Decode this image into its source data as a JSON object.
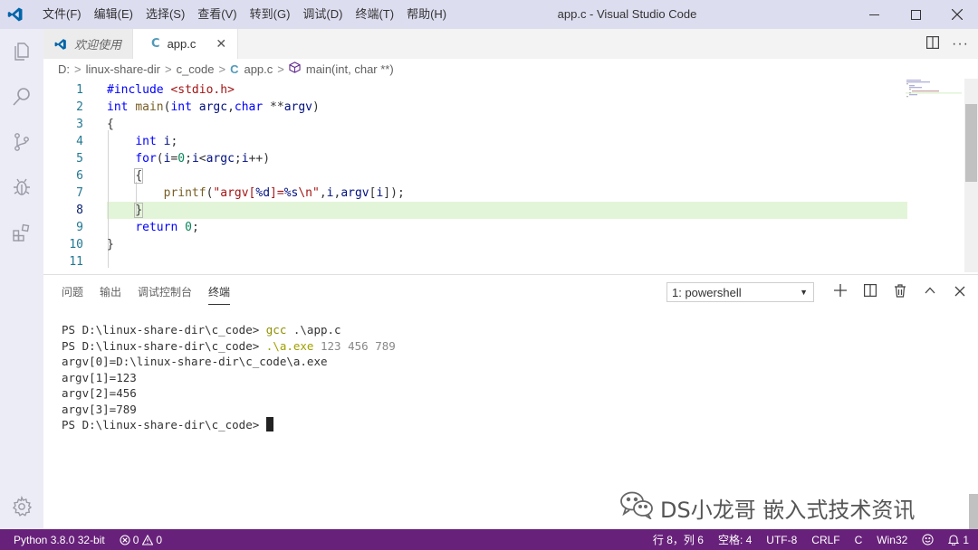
{
  "titlebar": {
    "title": "app.c - Visual Studio Code",
    "menu": [
      "文件(F)",
      "编辑(E)",
      "选择(S)",
      "查看(V)",
      "转到(G)",
      "调试(D)",
      "终端(T)",
      "帮助(H)"
    ]
  },
  "tabs": [
    {
      "label": "欢迎使用"
    },
    {
      "label": "app.c",
      "icon": "C",
      "close": "✕"
    }
  ],
  "breadcrumb": {
    "drive": "D:",
    "folder1": "linux-share-dir",
    "folder2": "c_code",
    "file_icon": "C",
    "file": "app.c",
    "symbol": "main(int, char **)",
    "sep": ">"
  },
  "editor": {
    "line_numbers": [
      "1",
      "2",
      "3",
      "4",
      "5",
      "6",
      "7",
      "8",
      "9",
      "10",
      "11"
    ],
    "current_line": 8
  },
  "panel": {
    "tabs": [
      "问题",
      "输出",
      "调试控制台",
      "终端"
    ],
    "active_tab": "终端",
    "terminal_select": "1: powershell",
    "terminal": {
      "prompt1": "PS D:\\linux-share-dir\\c_code> ",
      "cmd1": "gcc",
      "args1": " .\\app.c",
      "prompt2": "PS D:\\linux-share-dir\\c_code> ",
      "cmd2": ".\\a.exe",
      "args2": " 123 456 789",
      "out1": "argv[0]=D:\\linux-share-dir\\c_code\\a.exe",
      "out2": "argv[1]=123",
      "out3": "argv[2]=456",
      "out4": "argv[3]=789",
      "prompt3": "PS D:\\linux-share-dir\\c_code> "
    }
  },
  "watermark": "DS小龙哥 嵌入式技术资讯",
  "statusbar": {
    "python": "Python 3.8.0 32-bit",
    "errors": "0",
    "warnings": "0",
    "position": "行 8，列 6",
    "spaces": "空格: 4",
    "encoding": "UTF-8",
    "eol": "CRLF",
    "language": "C",
    "platform": "Win32",
    "notifications": "1"
  },
  "colors": {
    "statusbar": "#68217a",
    "titlebar": "#ddddf0",
    "current_line": "#e3f5d8",
    "accent": "#007acc"
  }
}
